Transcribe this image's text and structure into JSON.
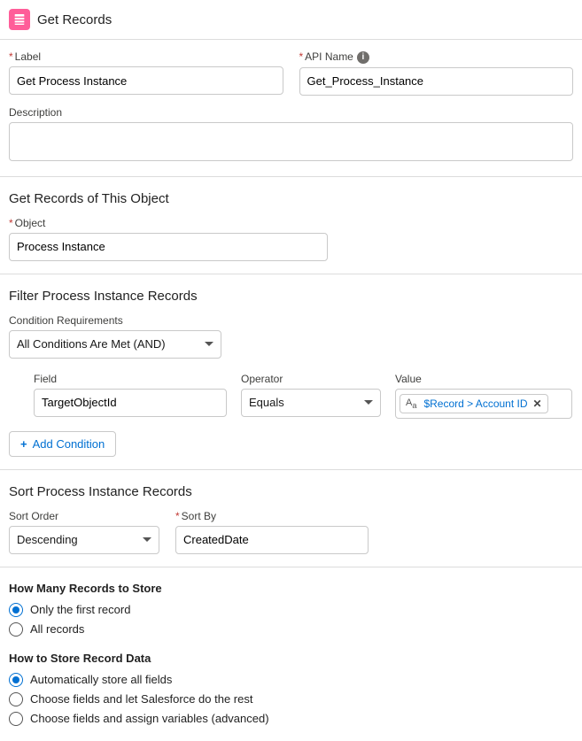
{
  "header": {
    "title": "Get Records"
  },
  "basic": {
    "label_label": "Label",
    "label_value": "Get Process Instance",
    "api_label": "API Name",
    "api_value": "Get_Process_Instance",
    "desc_label": "Description",
    "desc_value": ""
  },
  "object": {
    "heading": "Get Records of This Object",
    "label": "Object",
    "value": "Process Instance"
  },
  "filter": {
    "heading": "Filter Process Instance Records",
    "cond_req_label": "Condition Requirements",
    "cond_req_value": "All Conditions Are Met (AND)",
    "rows": [
      {
        "field_label": "Field",
        "field_value": "TargetObjectId",
        "op_label": "Operator",
        "op_value": "Equals",
        "val_label": "Value",
        "val_pill": "$Record > Account ID"
      }
    ],
    "add_btn": "Add Condition"
  },
  "sort": {
    "heading": "Sort Process Instance Records",
    "order_label": "Sort Order",
    "order_value": "Descending",
    "by_label": "Sort By",
    "by_value": "CreatedDate"
  },
  "store": {
    "count_heading": "How Many Records to Store",
    "count_options": [
      {
        "label": "Only the first record",
        "checked": true
      },
      {
        "label": "All records",
        "checked": false
      }
    ],
    "data_heading": "How to Store Record Data",
    "data_options": [
      {
        "label": "Automatically store all fields",
        "checked": true
      },
      {
        "label": "Choose fields and let Salesforce do the rest",
        "checked": false
      },
      {
        "label": "Choose fields and assign variables (advanced)",
        "checked": false
      }
    ]
  }
}
